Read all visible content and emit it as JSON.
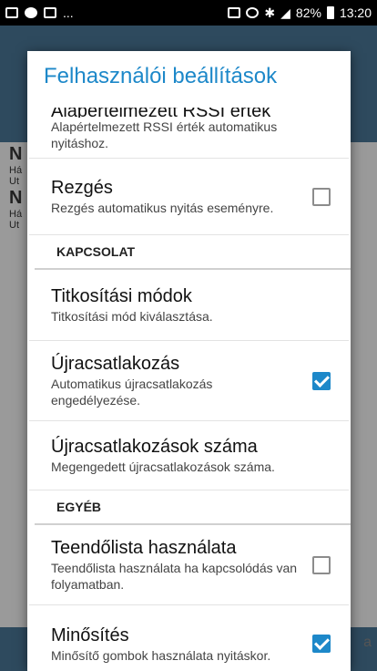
{
  "status_bar": {
    "dots": "...",
    "battery_percent": "82%",
    "time": "13:20"
  },
  "background": {
    "rows": [
      {
        "title": "N",
        "line1": "Há",
        "line2": "Ut"
      },
      {
        "title": "N",
        "line1": "Há",
        "line2": "Ut"
      }
    ],
    "side_text": "a"
  },
  "dialog": {
    "title": "Felhasználói beállítások",
    "items": [
      {
        "title": "Alapértelmezett RSSI érték",
        "summary": "Alapértelmezett RSSI érték automatikus nyitáshoz."
      },
      {
        "title": "Rezgés",
        "summary": "Rezgés automatikus nyitás eseményre.",
        "checked": false
      },
      {
        "title": "Titkosítási módok",
        "summary": "Titkosítási mód kiválasztása."
      },
      {
        "title": "Újracsatlakozás",
        "summary": "Automatikus újracsatlakozás engedélyezése.",
        "checked": true
      },
      {
        "title": "Újracsatlakozások száma",
        "summary": "Megengedett újracsatlakozások száma."
      },
      {
        "title": "Teendőlista használata",
        "summary": "Teendőlista használata ha kapcsolódás van folyamatban.",
        "checked": false
      },
      {
        "title": "Minősítés",
        "summary": "Minősítő gombok használata nyitáskor.",
        "checked": true
      }
    ],
    "sections": {
      "connection": "KAPCSOLAT",
      "other": "EGYÉB"
    }
  },
  "colors": {
    "accent": "#1d88c9",
    "appbar": "#2e4a5e"
  }
}
